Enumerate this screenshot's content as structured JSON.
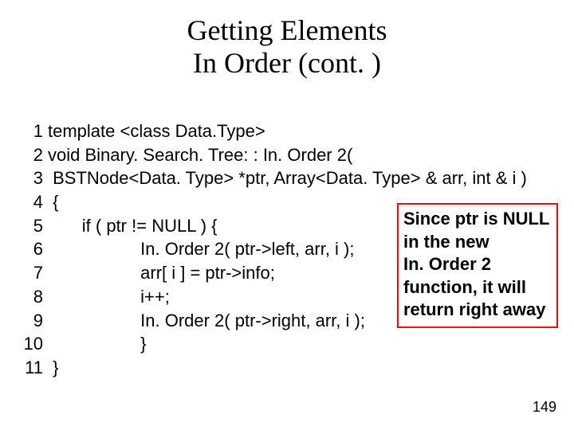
{
  "title_line1": "Getting Elements",
  "title_line2": "In Order (cont. )",
  "code": [
    {
      "n": "1",
      "t": "template <class Data.Type>"
    },
    {
      "n": "2",
      "t": "void Binary. Search. Tree: : In. Order 2("
    },
    {
      "n": "3",
      "t": " BSTNode<Data. Type> *ptr, Array<Data. Type> & arr, int & i )"
    },
    {
      "n": "4",
      "t": " {"
    },
    {
      "n": "5",
      "t": "       if ( ptr != NULL ) {"
    },
    {
      "n": "6",
      "t": "                   In. Order 2( ptr->left, arr, i );"
    },
    {
      "n": "7",
      "t": "                   arr[ i ] = ptr->info;"
    },
    {
      "n": "8",
      "t": "                   i++;"
    },
    {
      "n": "9",
      "t": "                   In. Order 2( ptr->right, arr, i );"
    },
    {
      "n": "10",
      "t": "                   }"
    },
    {
      "n": "11",
      "t": " }"
    }
  ],
  "callout_l1": "Since ptr is NULL",
  "callout_l2": "in the new",
  "callout_l3": "In. Order 2",
  "callout_l4": "function, it will",
  "callout_l5": "return right away",
  "page_number": "149"
}
